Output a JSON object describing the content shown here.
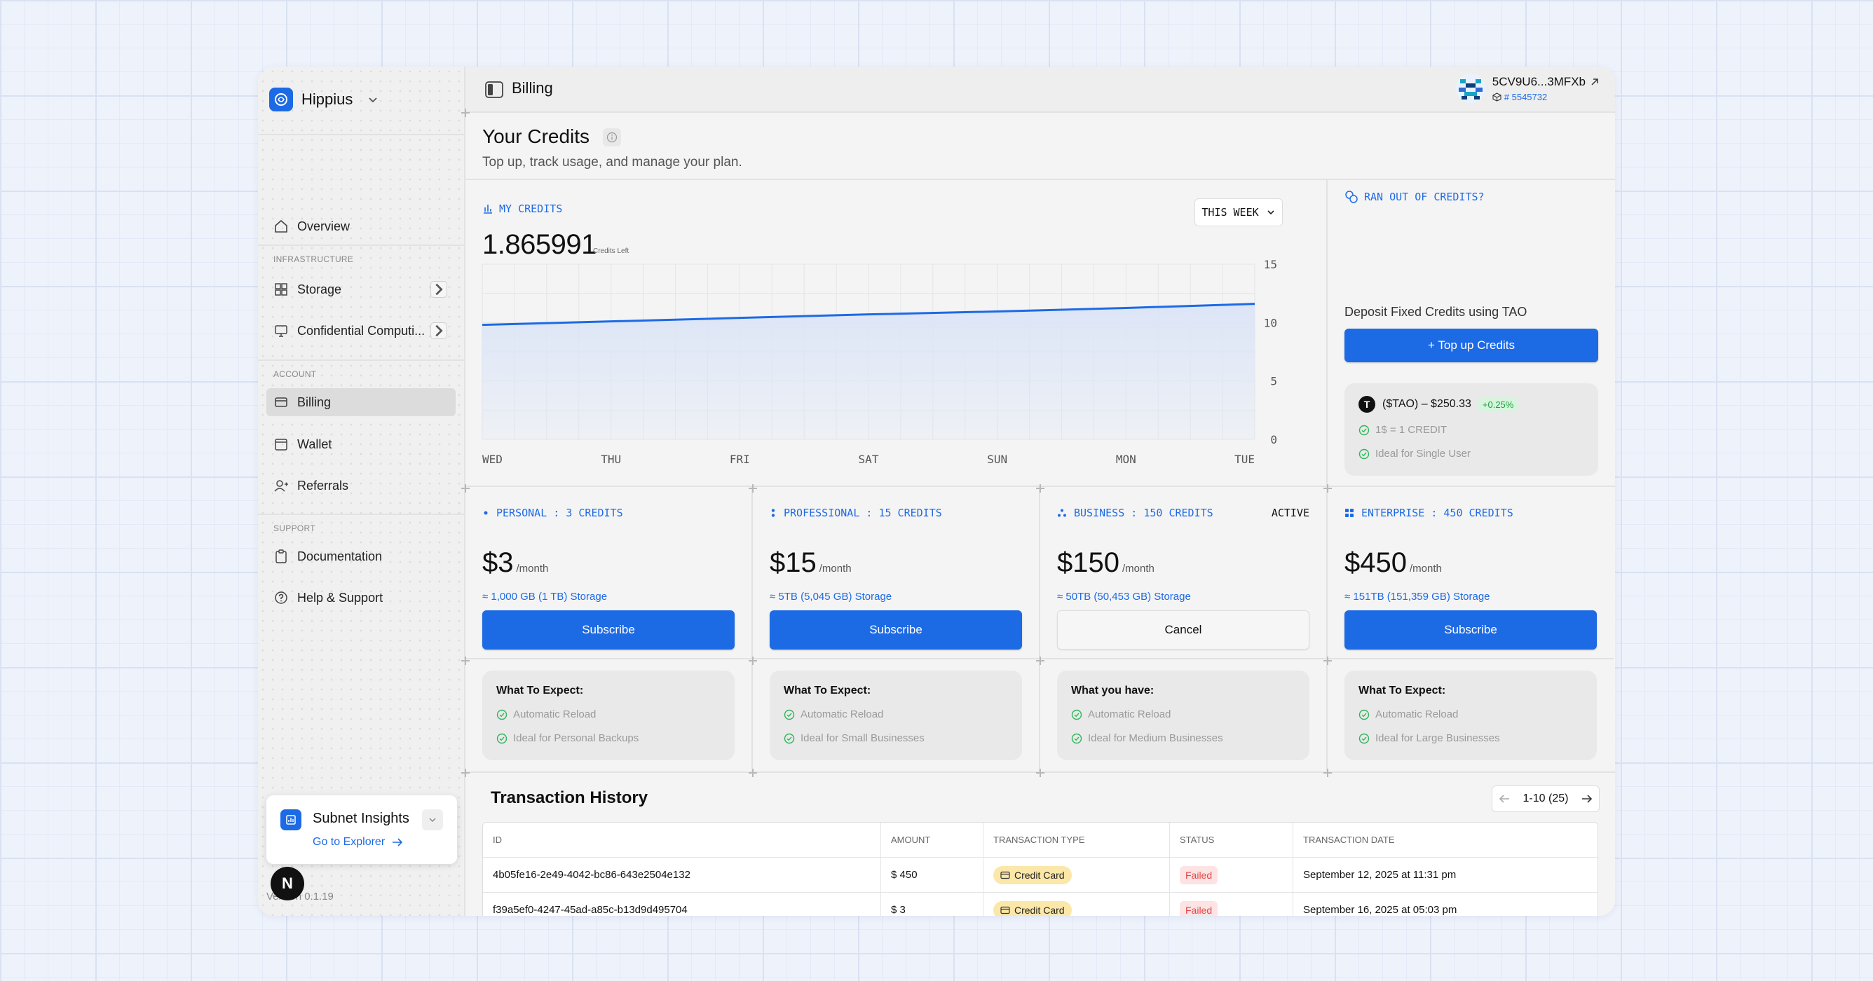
{
  "sidebar": {
    "brand": "Hippius",
    "items": [
      {
        "label": "Overview"
      },
      {
        "label": "Storage"
      },
      {
        "label": "Confidential Computi..."
      },
      {
        "label": "Billing"
      },
      {
        "label": "Wallet"
      },
      {
        "label": "Referrals"
      },
      {
        "label": "Documentation"
      },
      {
        "label": "Help & Support"
      }
    ],
    "sections": {
      "infrastructure": "INFRASTRUCTURE",
      "account": "ACCOUNT",
      "support": "SUPPORT"
    },
    "subnet": {
      "title": "Subnet Insights",
      "link": "Go to Explorer"
    },
    "version": "Version 0.1.19",
    "badge": "N"
  },
  "topbar": {
    "title": "Billing",
    "user": {
      "address": "5CV9U6...3MFXb",
      "account_id": "# 5545732"
    }
  },
  "credits": {
    "title": "Your Credits",
    "subtitle": "Top up, track usage, and manage your plan."
  },
  "my_credits": {
    "label": "MY CREDITS",
    "value": "1.865991",
    "unit": "Credits Left",
    "range_button": "THIS WEEK"
  },
  "chart_data": {
    "type": "area",
    "categories": [
      "WED",
      "THU",
      "FRI",
      "SAT",
      "SUN",
      "MON",
      "TUE"
    ],
    "values": [
      9.8,
      10.1,
      10.4,
      10.7,
      10.95,
      11.25,
      11.6
    ],
    "yticks": [
      "15",
      "10",
      "5",
      "0"
    ],
    "ylim": [
      0,
      15
    ],
    "grid": true,
    "colors": {
      "line": "#1d6ae5",
      "fill": "#dce5f7"
    }
  },
  "topup": {
    "label": "RAN OUT OF CREDITS?",
    "deposit_text": "Deposit Fixed Credits using TAO",
    "button": "+ Top up Credits",
    "tao": {
      "logo": "T",
      "price": "($TAO) – $250.33",
      "change": "+0.25%"
    },
    "lines": [
      "1$ = 1 CREDIT",
      "Ideal for Single User"
    ]
  },
  "plans": [
    {
      "label": "PERSONAL : 3 CREDITS",
      "active": "",
      "price": "$3",
      "per": "/month",
      "storage": "≈ 1,000 GB (1 TB) Storage",
      "button": "Subscribe",
      "button_style": "blue",
      "expect_title": "What To Expect:",
      "lines": [
        "Automatic Reload",
        "Ideal for Personal Backups"
      ]
    },
    {
      "label": "PROFESSIONAL : 15 CREDITS",
      "active": "",
      "price": "$15",
      "per": "/month",
      "storage": "≈ 5TB (5,045 GB) Storage",
      "button": "Subscribe",
      "button_style": "blue",
      "expect_title": "What To Expect:",
      "lines": [
        "Automatic Reload",
        "Ideal for Small Businesses"
      ]
    },
    {
      "label": "BUSINESS : 150 CREDITS",
      "active": "ACTIVE",
      "price": "$150",
      "per": "/month",
      "storage": "≈ 50TB (50,453 GB) Storage",
      "button": "Cancel",
      "button_style": "white",
      "expect_title": "What you have:",
      "lines": [
        "Automatic Reload",
        "Ideal for Medium Businesses"
      ]
    },
    {
      "label": "ENTERPRISE : 450 CREDITS",
      "active": "",
      "price": "$450",
      "per": "/month",
      "storage": "≈ 151TB (151,359 GB) Storage",
      "button": "Subscribe",
      "button_style": "blue",
      "expect_title": "What To Expect:",
      "lines": [
        "Automatic Reload",
        "Ideal for Large Businesses"
      ]
    }
  ],
  "transactions": {
    "title": "Transaction History",
    "pager": "1-10 (25)",
    "columns": [
      "ID",
      "AMOUNT",
      "TRANSACTION TYPE",
      "STATUS",
      "TRANSACTION DATE"
    ],
    "rows": [
      {
        "id": "4b05fe16-2e49-4042-bc86-643e2504e132",
        "amount": "$ 450",
        "type": "Credit Card",
        "status": "Failed",
        "date": "September 12, 2025 at 11:31 pm"
      },
      {
        "id": "f39a5ef0-4247-45ad-a85c-b13d9d495704",
        "amount": "$ 3",
        "type": "Credit Card",
        "status": "Failed",
        "date": "September 16, 2025 at 05:03 pm"
      }
    ]
  },
  "colors": {
    "accent": "#1d6ae5",
    "success": "#1e9e40",
    "danger": "#e24848"
  }
}
